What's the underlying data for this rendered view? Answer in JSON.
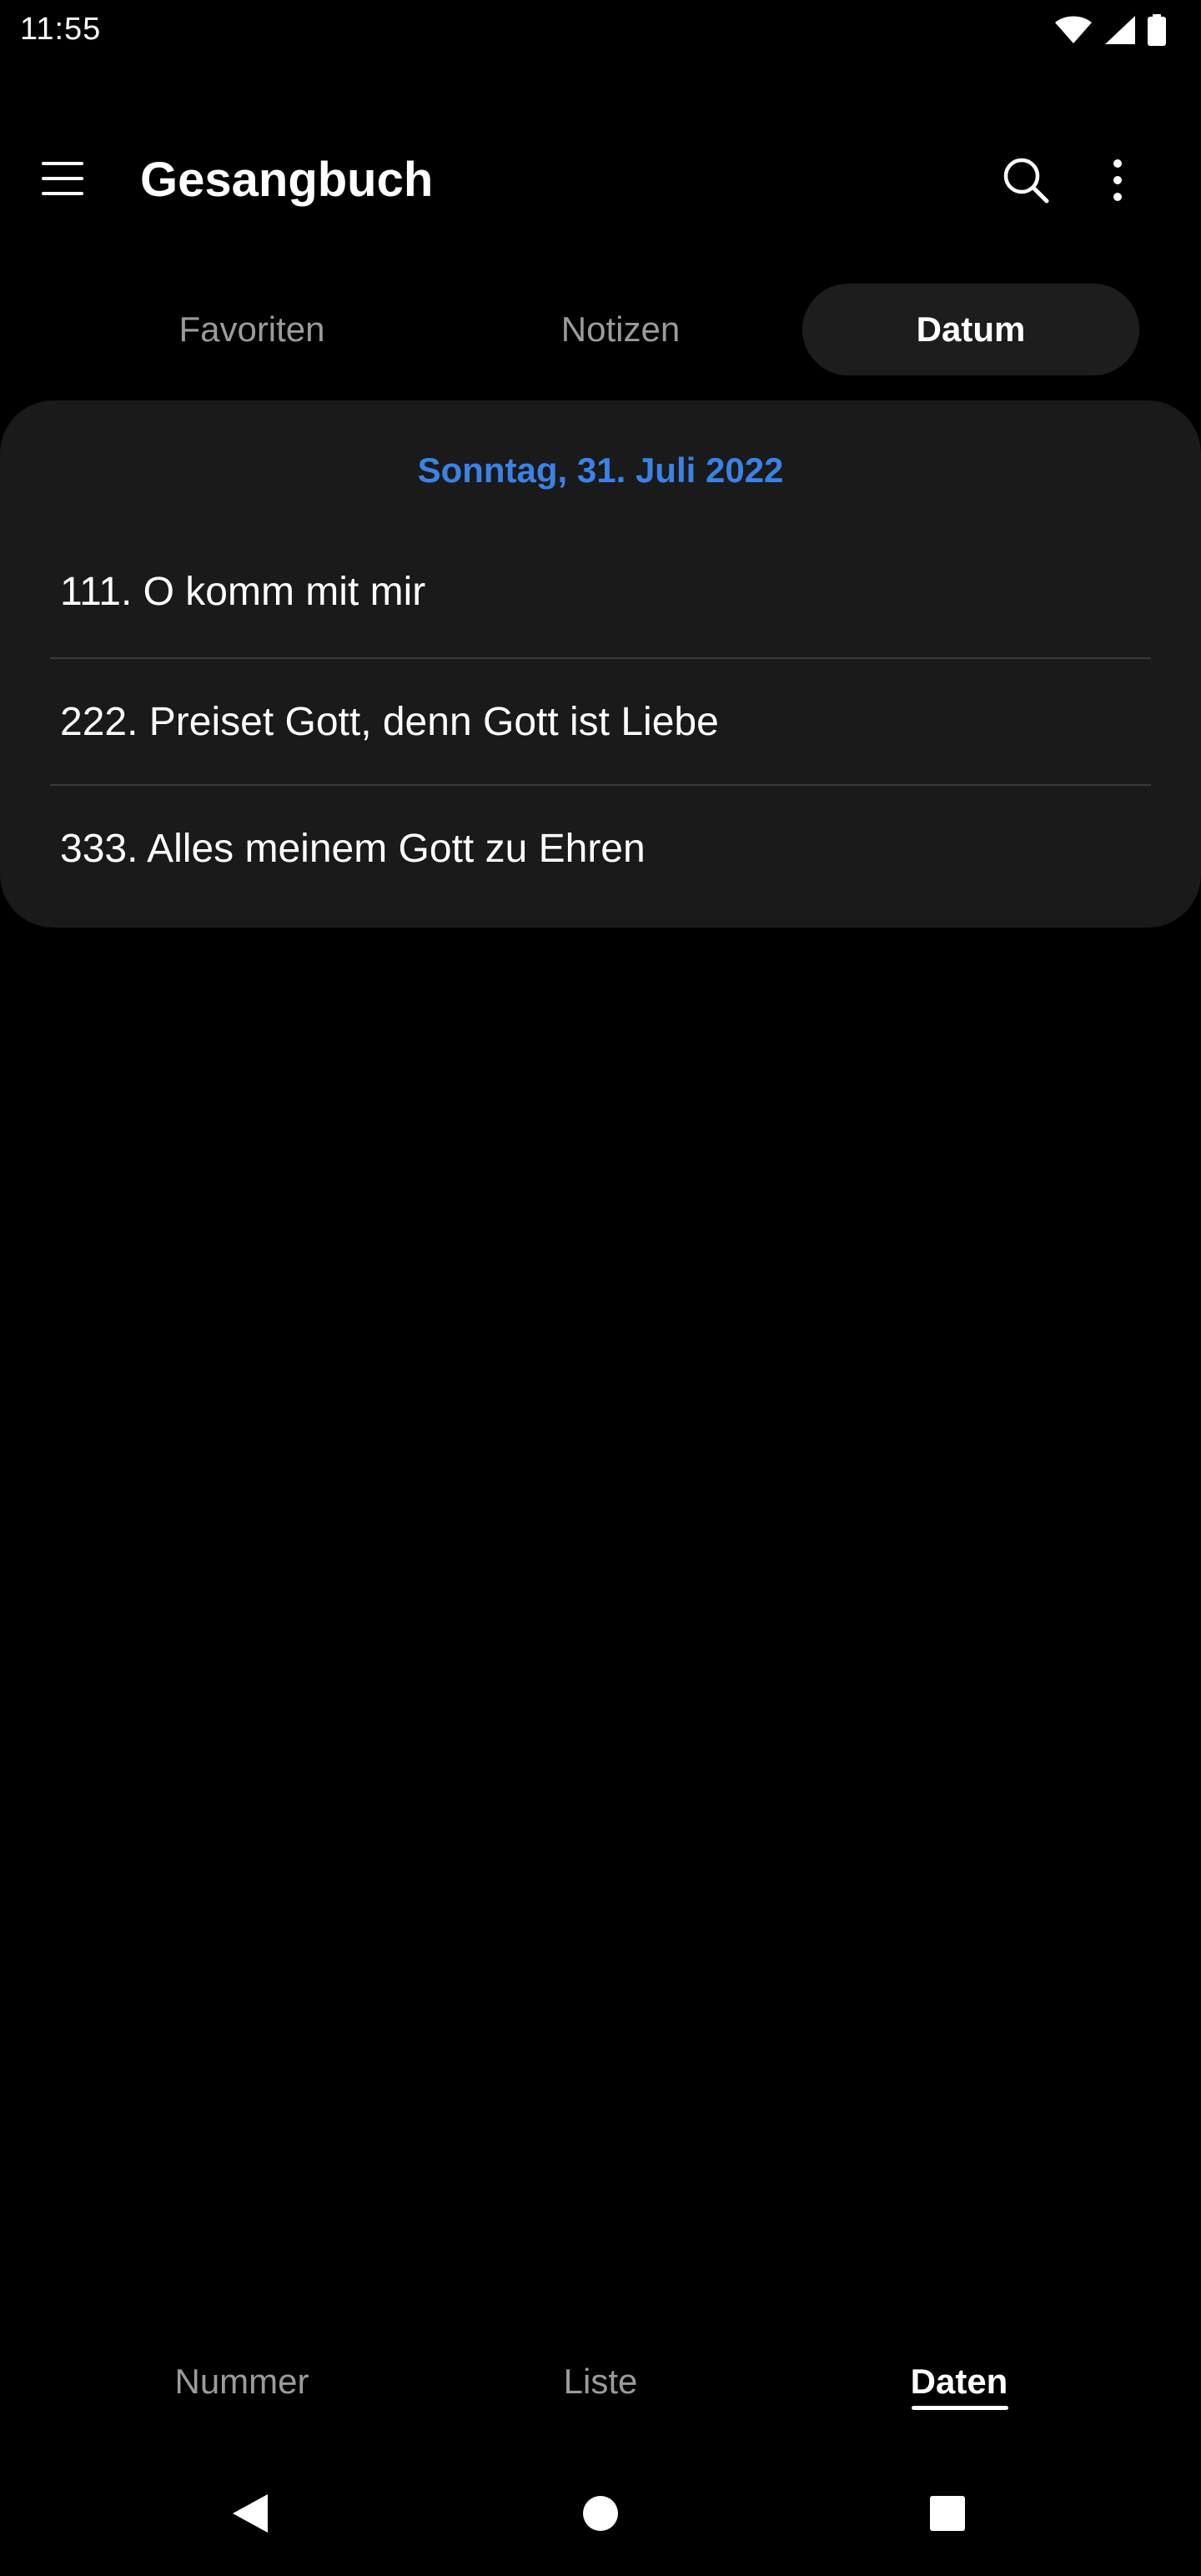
{
  "status_bar": {
    "time": "11:55",
    "icons": [
      "wifi-icon",
      "signal-icon",
      "battery-icon"
    ]
  },
  "app_bar": {
    "title": "Gesangbuch",
    "menu_icon": "menu-icon",
    "search_icon": "search-icon",
    "more_icon": "more-vert-icon"
  },
  "tabs": [
    {
      "label": "Favoriten",
      "selected": false
    },
    {
      "label": "Notizen",
      "selected": false
    },
    {
      "label": "Datum",
      "selected": true
    }
  ],
  "card": {
    "date": "Sonntag, 31. Juli 2022",
    "hymns": [
      "111. O komm mit mir",
      "222. Preiset Gott, denn Gott ist Liebe",
      "333. Alles meinem Gott zu Ehren"
    ]
  },
  "bottom_nav": [
    {
      "label": "Nummer",
      "selected": false
    },
    {
      "label": "Liste",
      "selected": false
    },
    {
      "label": "Daten",
      "selected": true
    }
  ],
  "system_nav": {
    "icons": [
      "back-icon",
      "home-icon",
      "recents-icon"
    ]
  },
  "colors": {
    "background": "#000000",
    "card": "#1a1a1a",
    "accent": "#3b82e6",
    "selected_tab": "#1d1d1d",
    "muted_text": "#9b9b9b"
  }
}
